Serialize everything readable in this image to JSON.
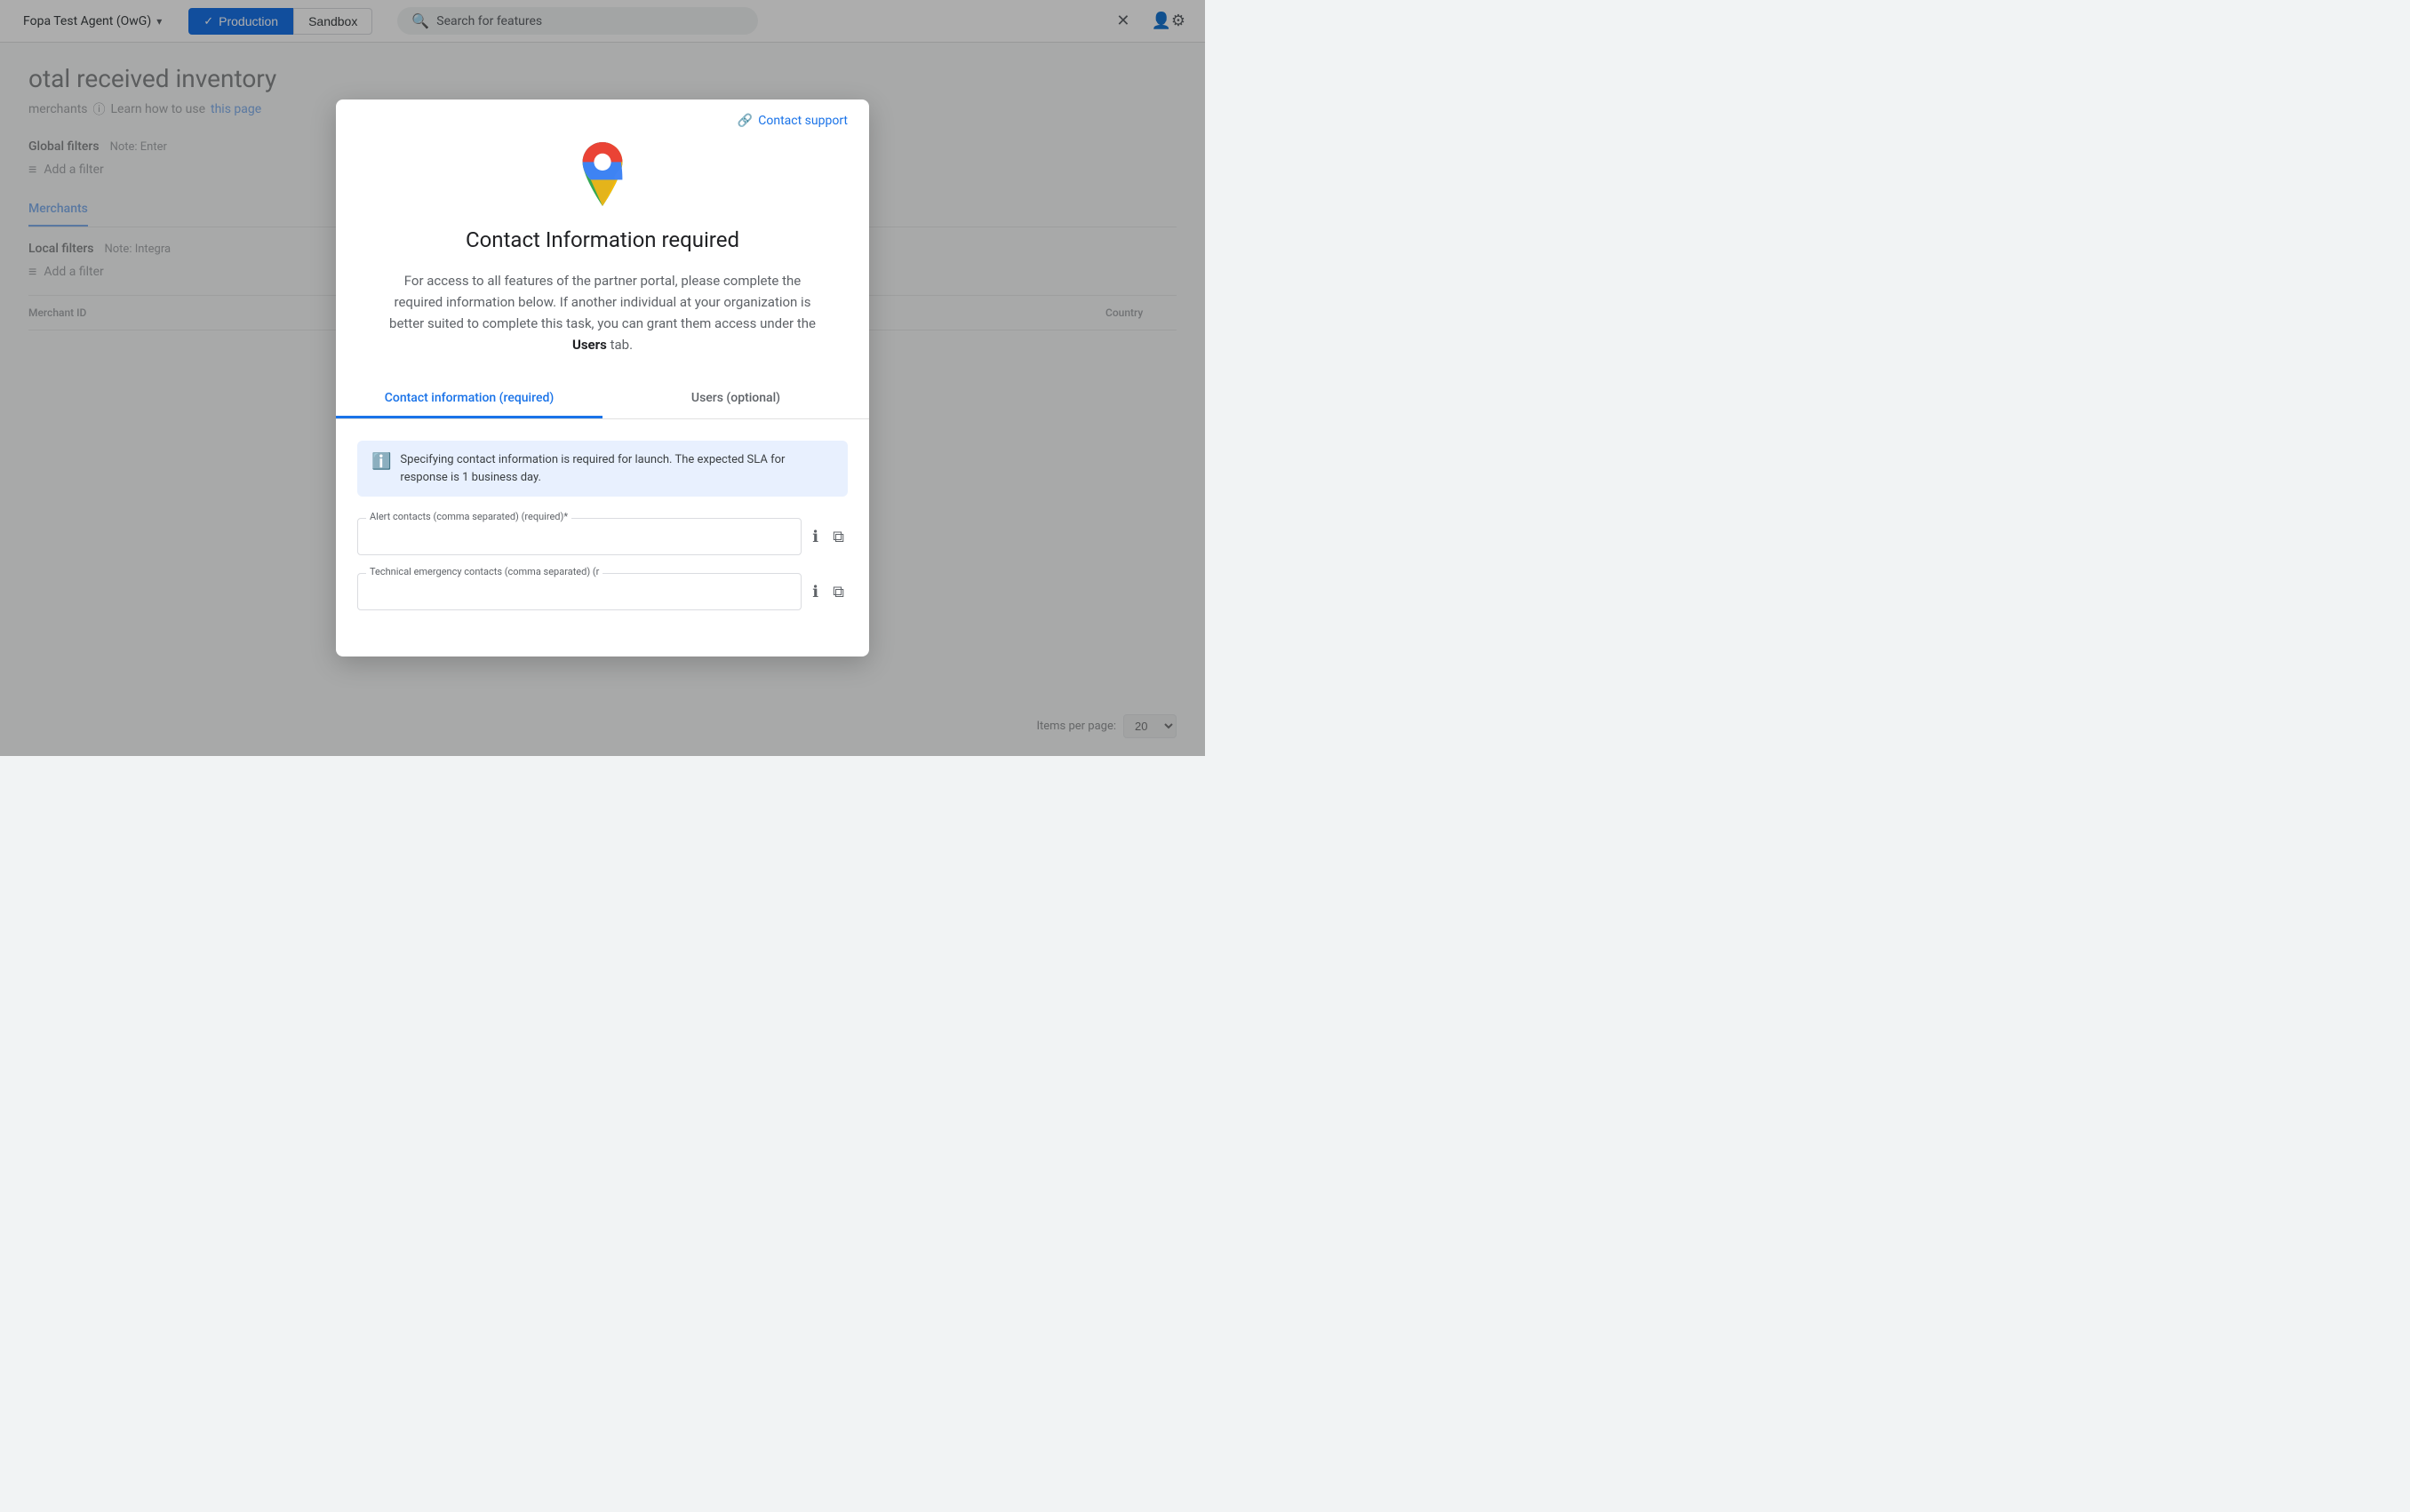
{
  "nav": {
    "account_label": "Fopa Test Agent (OwG)",
    "production_label": "Production",
    "sandbox_label": "Sandbox",
    "search_placeholder": "Search for features",
    "close_tooltip": "Close",
    "account_settings_tooltip": "Account settings"
  },
  "background": {
    "page_title": "otal received inventory",
    "merchants_label": "merchants",
    "info_icon": "ⓘ",
    "learn_text": "Learn how to use",
    "this_page_text": "this page",
    "global_filters_label": "Global filters",
    "global_filters_note": "Note: Enter",
    "add_filter_label": "Add a filter",
    "tab_merchants": "Merchants",
    "local_filters_label": "Local filters",
    "local_filters_note": "Note: Integra",
    "table_col_merchant_id": "Merchant ID",
    "table_col_country": "Country",
    "items_per_page_label": "Items per page:",
    "items_per_page_value": "20"
  },
  "modal": {
    "contact_support_label": "Contact support",
    "title": "Contact Information required",
    "body_text": "For access to all features of the partner portal, please complete the required information below. If another individual at your organization is better suited to complete this task, you can grant them access under the",
    "users_tab_ref": "Users",
    "body_text_end": "tab.",
    "tab_contact_required": "Contact information (required)",
    "tab_users_optional": "Users (optional)",
    "banner_text": "Specifying contact information is required for launch. The expected SLA for response is 1 business day.",
    "alert_contacts_label": "Alert contacts (comma separated) (required)*",
    "alert_contacts_placeholder": "",
    "tech_emergency_label": "Technical emergency contacts (comma separated) (r",
    "tech_emergency_placeholder": "",
    "info_icon_tooltip": "Info",
    "copy_icon_tooltip": "Copy"
  }
}
